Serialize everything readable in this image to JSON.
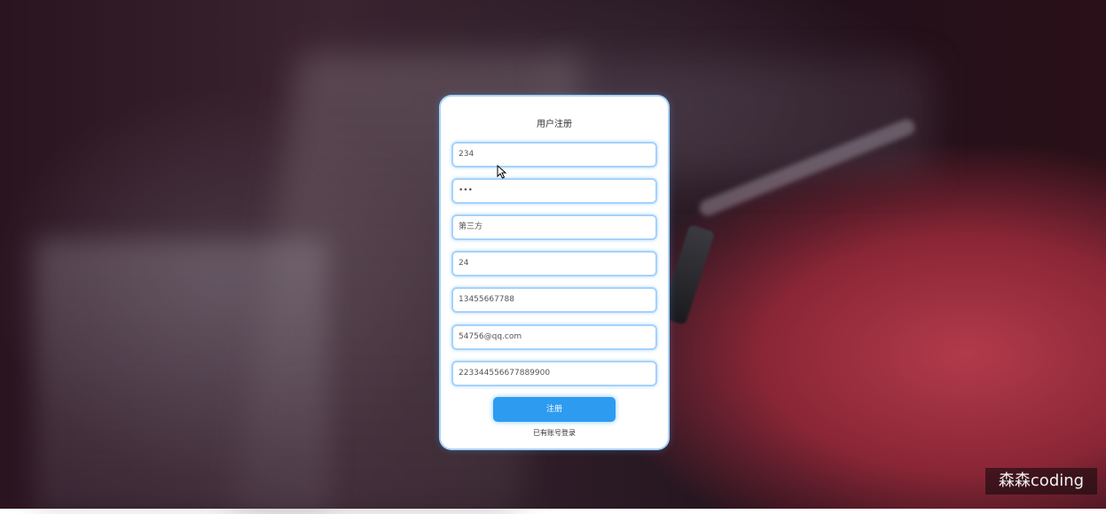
{
  "form": {
    "title": "用户注册",
    "fields": [
      {
        "name": "username",
        "value": "234"
      },
      {
        "name": "password",
        "value": "•••"
      },
      {
        "name": "nickname",
        "value": "第三方"
      },
      {
        "name": "age",
        "value": "24"
      },
      {
        "name": "phone",
        "value": "13455667788"
      },
      {
        "name": "email",
        "value": "54756@qq.com"
      },
      {
        "name": "id-number",
        "value": "223344556677889900"
      }
    ],
    "submit_label": "注册",
    "login_link": "已有账号登录"
  },
  "watermark": "森森coding",
  "colors": {
    "accent": "#2d9bf0",
    "field_border": "#a6d2f9",
    "card_bg": "#ffffff",
    "vinyl_red": "#b23a4a"
  }
}
